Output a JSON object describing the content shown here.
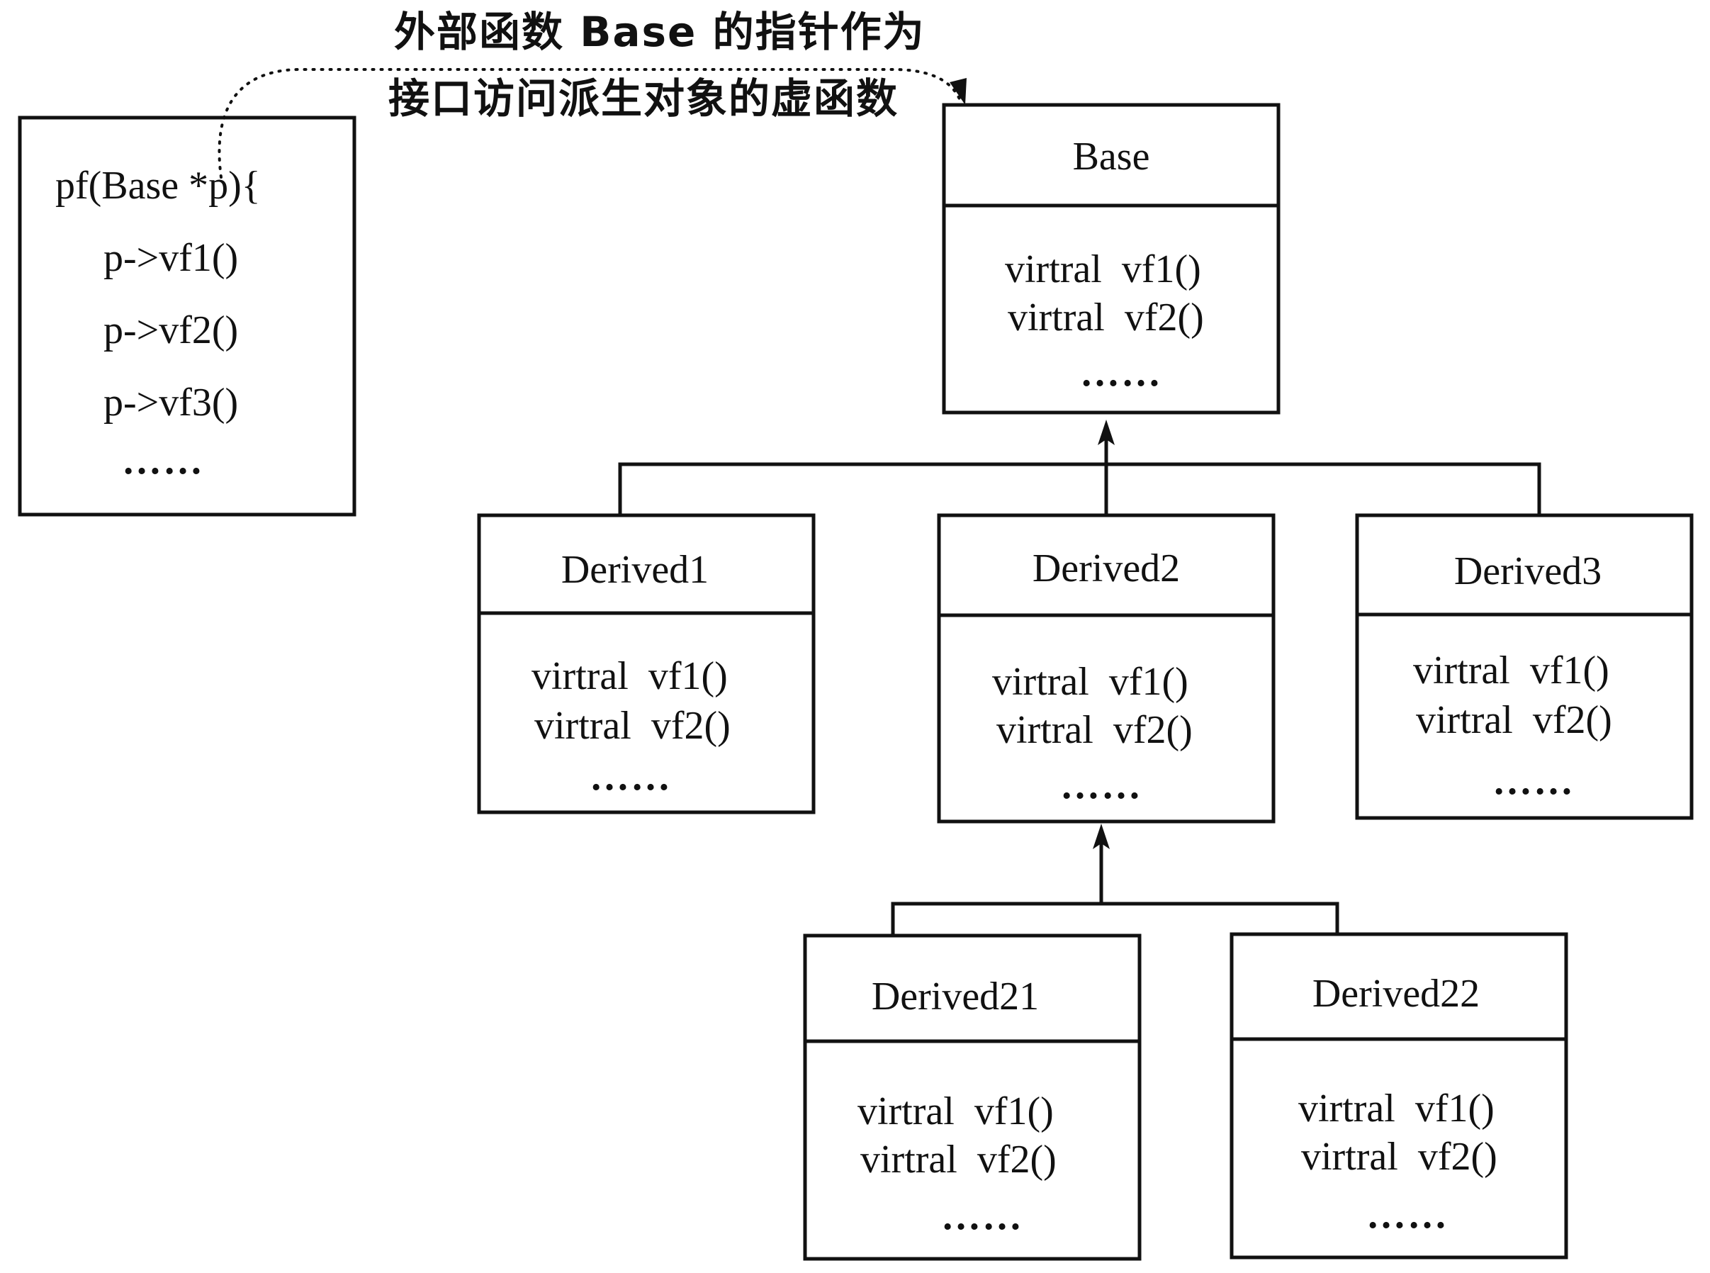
{
  "caption": {
    "line1": "外部函数 Base 的指针作为",
    "line2": "接口访问派生对象的虚函数"
  },
  "function_box": {
    "signature": "pf(Base *p){",
    "calls": [
      "p->vf1()",
      "p->vf2()",
      "p->vf3()"
    ],
    "ellipsis": "……"
  },
  "classes": {
    "base": {
      "name": "Base",
      "methods": [
        "virtral  vf1()",
        "virtral  vf2()"
      ],
      "ellipsis": "……"
    },
    "derived1": {
      "name": "Derived1",
      "methods": [
        "virtral  vf1()",
        "virtral  vf2()"
      ],
      "ellipsis": "……"
    },
    "derived2": {
      "name": "Derived2",
      "methods": [
        "virtral  vf1()",
        "virtral  vf2()"
      ],
      "ellipsis": "……"
    },
    "derived3": {
      "name": "Derived3",
      "methods": [
        "virtral  vf1()",
        "virtral  vf2()"
      ],
      "ellipsis": "……"
    },
    "derived21": {
      "name": "Derived21",
      "methods": [
        "virtral  vf1()",
        "virtral  vf2()"
      ],
      "ellipsis": "……"
    },
    "derived22": {
      "name": "Derived22",
      "methods": [
        "virtral  vf1()",
        "virtral  vf2()"
      ],
      "ellipsis": "……"
    }
  }
}
